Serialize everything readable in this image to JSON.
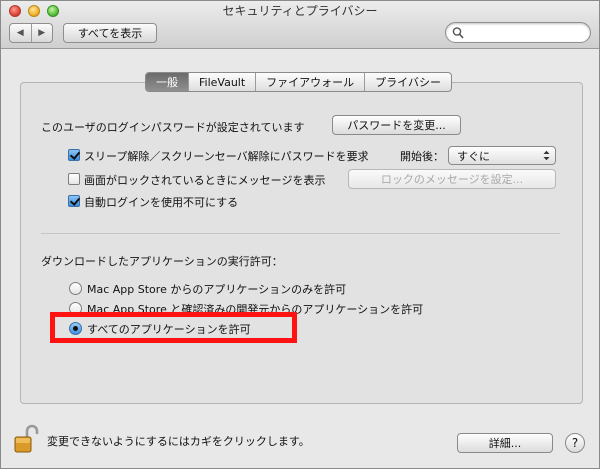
{
  "window": {
    "title": "セキュリティとプライバシー"
  },
  "toolbar": {
    "back_glyph": "◀",
    "forward_glyph": "▶",
    "show_all_label": "すべてを表示",
    "search_placeholder": ""
  },
  "tabs": [
    {
      "label": "一般",
      "active": true
    },
    {
      "label": "FileVault",
      "active": false
    },
    {
      "label": "ファイアウォール",
      "active": false
    },
    {
      "label": "プライバシー",
      "active": false
    }
  ],
  "general": {
    "login_password_label": "このユーザのログインパスワードが設定されています",
    "change_password_button": "パスワードを変更...",
    "require_password": {
      "label": "スリープ解除／スクリーンセーバ解除にパスワードを要求",
      "checked": true,
      "after_label": "開始後：",
      "after_value": "すぐに"
    },
    "show_message": {
      "label": "画面がロックされているときにメッセージを表示",
      "checked": false,
      "button": "ロックのメッセージを設定..."
    },
    "disable_autologin": {
      "label": "自動ログインを使用不可にする",
      "checked": true
    },
    "download_heading": "ダウンロードしたアプリケーションの実行許可：",
    "download_options": [
      {
        "label": "Mac App Store からのアプリケーションのみを許可",
        "selected": false
      },
      {
        "label": "Mac App Store と確認済みの開発元からのアプリケーションを許可",
        "selected": false
      },
      {
        "label": "すべてのアプリケーションを許可",
        "selected": true
      }
    ]
  },
  "footer": {
    "lock_text": "変更できないようにするにはカギをクリックします。",
    "advanced_button": "詳細...",
    "help_glyph": "?"
  },
  "colors": {
    "highlight_border": "#ff1212",
    "window_background": "#e8e8e8"
  }
}
